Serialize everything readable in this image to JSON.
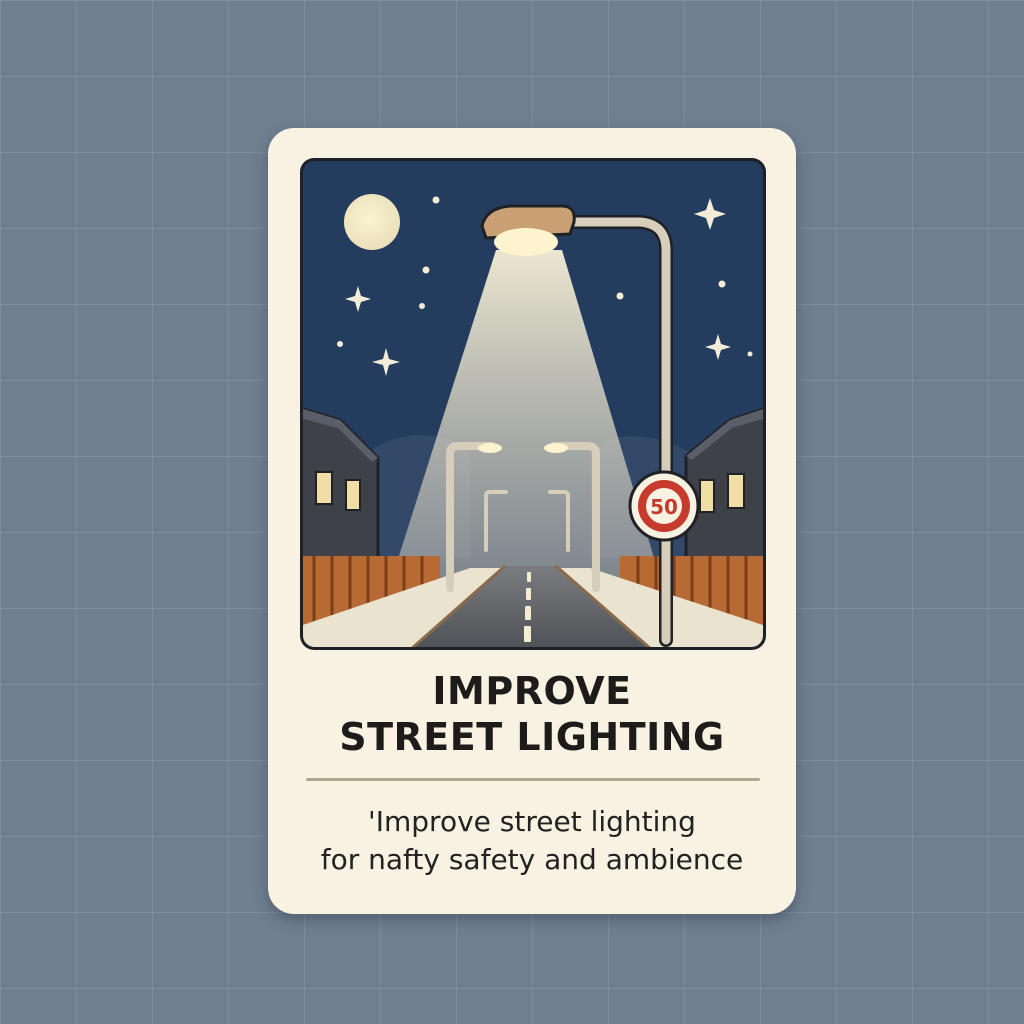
{
  "card": {
    "title_line_1": "IMPROVE",
    "title_line_2": "STREET LIGHTING",
    "description_line_1": "'Improve street lighting",
    "description_line_2": "for nafty safety and ambience"
  },
  "illustration": {
    "speed_sign_text": "50",
    "colors": {
      "sky": "#243d5e",
      "light_beam": "#f3ecd2",
      "lamp_glow": "#fdf3cf",
      "road": "#55585c",
      "fence": "#b86a35",
      "house": "#3e4148",
      "sign_red": "#c63b2e",
      "pole": "#d6cdbb"
    },
    "icons": [
      "moon-icon",
      "star-icon",
      "street-lamp-icon",
      "speed-limit-sign-icon",
      "house-icon"
    ]
  }
}
